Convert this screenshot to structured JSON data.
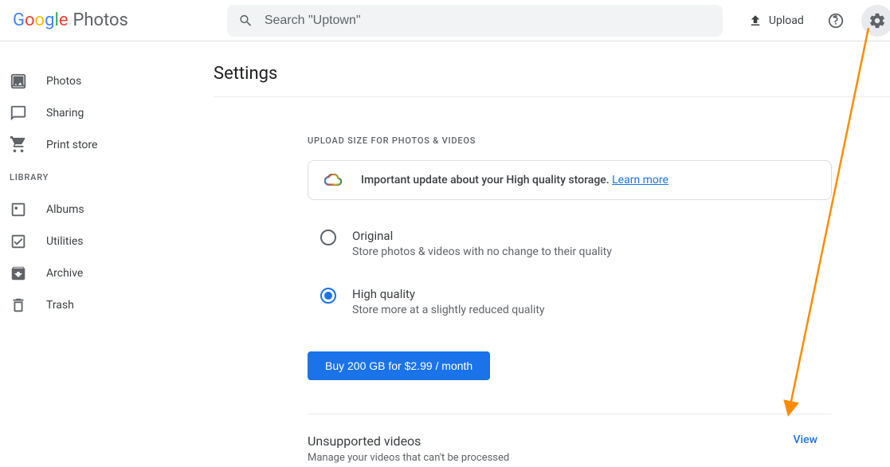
{
  "header": {
    "logo_product": "Photos",
    "search_placeholder": "Search \"Uptown\"",
    "upload_label": "Upload"
  },
  "sidebar": {
    "items_top": [
      {
        "label": "Photos"
      },
      {
        "label": "Sharing"
      },
      {
        "label": "Print store"
      }
    ],
    "library_label": "LIBRARY",
    "items_library": [
      {
        "label": "Albums"
      },
      {
        "label": "Utilities"
      },
      {
        "label": "Archive"
      },
      {
        "label": "Trash"
      }
    ]
  },
  "main": {
    "title": "Settings",
    "upload_section": {
      "label": "UPLOAD SIZE FOR PHOTOS & VIDEOS",
      "info_text": "Important update about your High quality storage. ",
      "info_link": "Learn more",
      "options": [
        {
          "title": "Original",
          "desc": "Store photos & videos with no change to their quality",
          "selected": false
        },
        {
          "title": "High quality",
          "desc": "Store more at a slightly reduced quality",
          "selected": true
        }
      ],
      "buy_btn": "Buy 200 GB for $2.99 / month"
    },
    "unsupported": {
      "title": "Unsupported videos",
      "desc": "Manage your videos that can't be processed",
      "action": "View"
    }
  }
}
